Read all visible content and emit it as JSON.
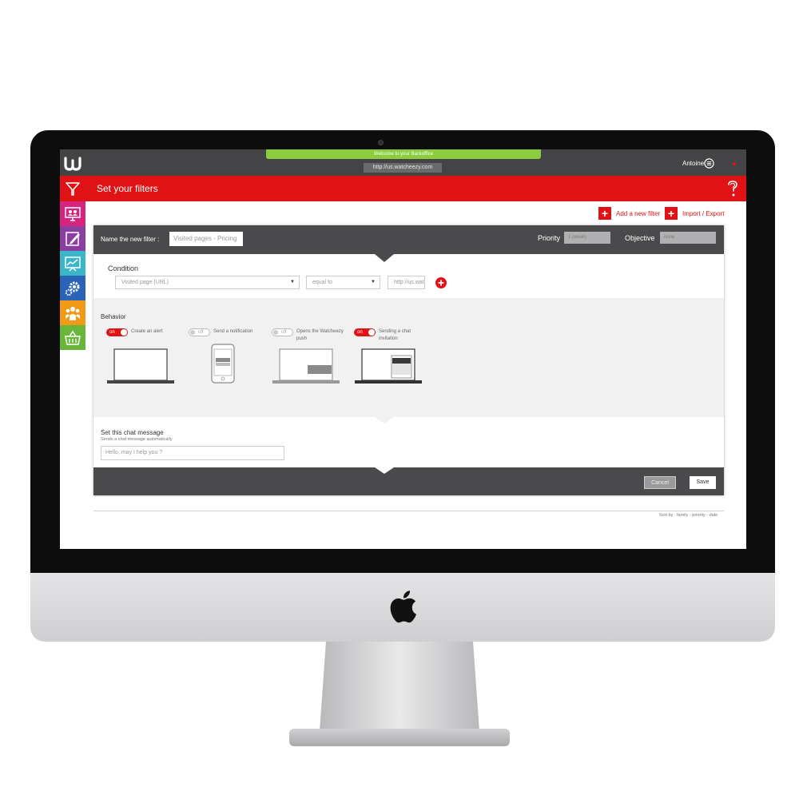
{
  "topbar": {
    "welcome": "Welcome to your Backoffice",
    "url": "http://us.watcheezy.com",
    "user": "Antoine"
  },
  "titlebar": {
    "title": "Set your filters"
  },
  "sidebar": {
    "items": [
      {
        "icon": "filter-icon",
        "color": "#e01215"
      },
      {
        "icon": "monitor-users-icon",
        "color": "#d6257e"
      },
      {
        "icon": "edit-icon",
        "color": "#8a3fa0"
      },
      {
        "icon": "chart-board-icon",
        "color": "#3bb6c9"
      },
      {
        "icon": "gears-icon",
        "color": "#2a63b8"
      },
      {
        "icon": "team-icon",
        "color": "#f29a17"
      },
      {
        "icon": "basket-icon",
        "color": "#6ab63a"
      }
    ]
  },
  "actions": {
    "add_filter": "Add a new filter",
    "import_export": "Import / Export",
    "plus": "+"
  },
  "filter": {
    "name_label": "Name the new filter :",
    "name_value": "Visited pages - Pricing",
    "priority_label": "Priority",
    "priority_value": "1 (weak)",
    "objective_label": "Objective",
    "objective_value": "none"
  },
  "condition": {
    "title": "Condition",
    "type_value": "Visited page (URL)",
    "operator_value": "equal to",
    "value": "http://us.watcheezy.com/pricing",
    "arrow": "▼"
  },
  "behavior": {
    "title": "Behavior",
    "items": [
      {
        "state": "on",
        "label": "Create an alert"
      },
      {
        "state": "off",
        "label": "Send a notification"
      },
      {
        "state": "off",
        "label": "Opens the Watcheezy push"
      },
      {
        "state": "on",
        "label": "Sending a chat invitation"
      }
    ]
  },
  "chat": {
    "title": "Set this chat message",
    "subtitle": "Sends a chat message automatically",
    "placeholder": "Hello, may I help you ?"
  },
  "footer": {
    "cancel": "Cancel",
    "save": "Save"
  },
  "sort": {
    "text": "Sort by : family - priority - date"
  },
  "colors": {
    "accent": "#e01215",
    "dark": "#4a4a4c",
    "welcome": "#8ccd3e"
  }
}
